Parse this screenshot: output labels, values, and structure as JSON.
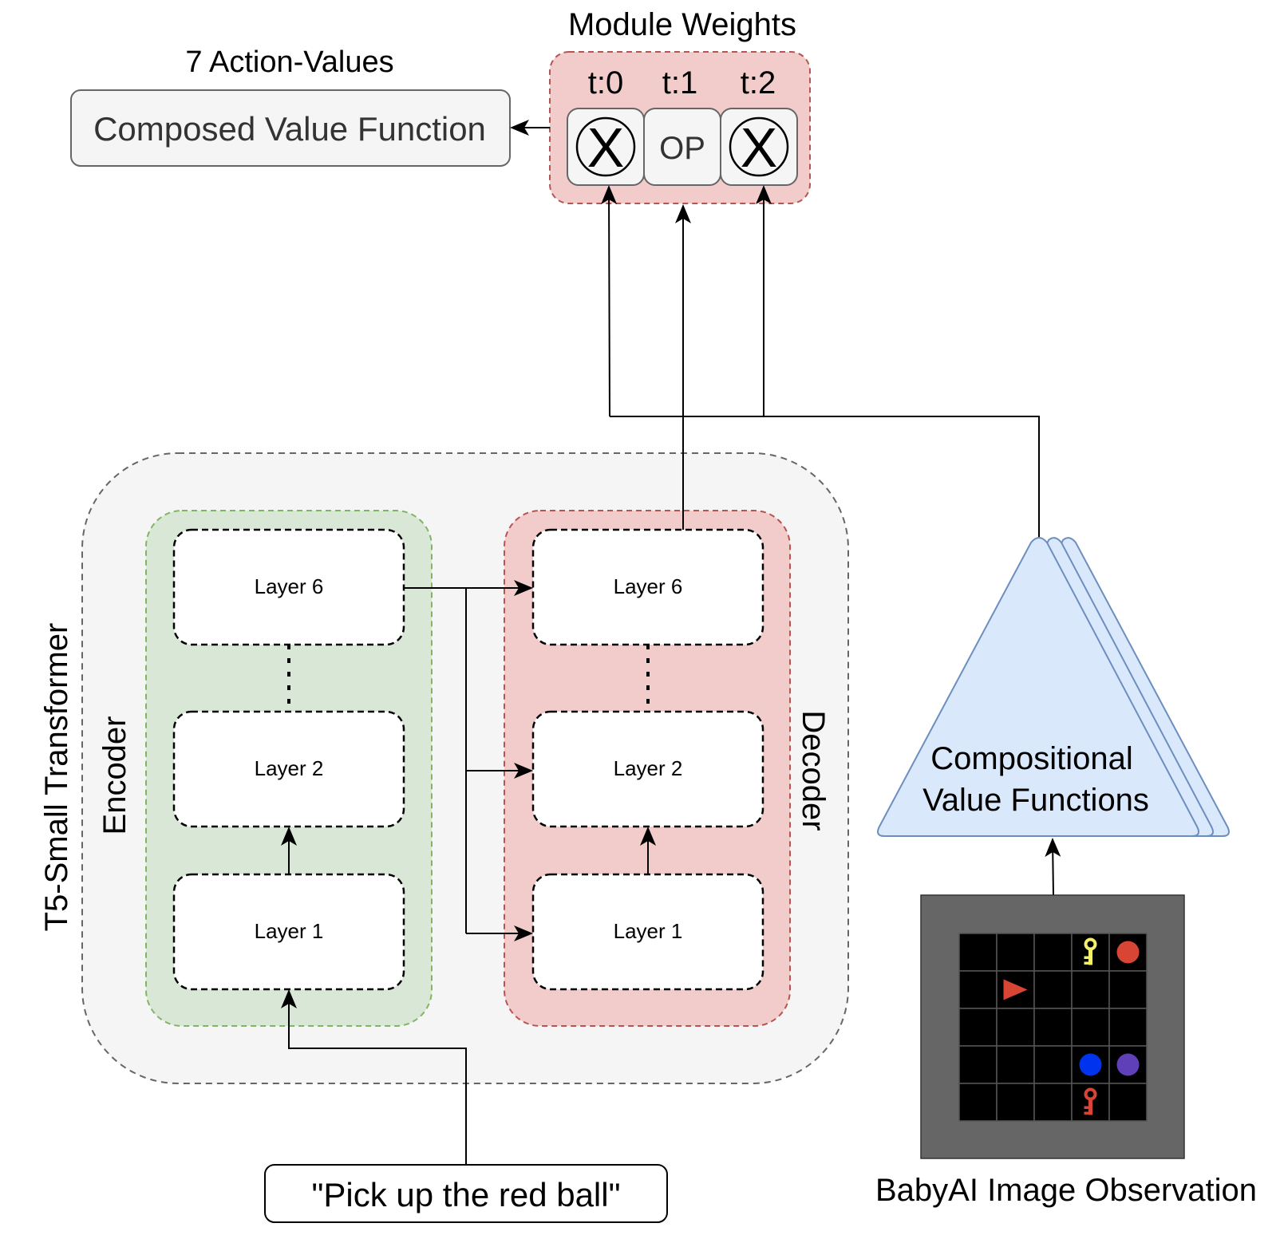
{
  "top": {
    "module_weights_title": "Module Weights",
    "action_values_title": "7 Action-Values",
    "composed_value_function": "Composed Value Function",
    "module_slots": [
      {
        "label": "t:0",
        "content": "multiply-circle-icon"
      },
      {
        "label": "t:1",
        "content": "OP"
      },
      {
        "label": "t:2",
        "content": "multiply-circle-icon"
      }
    ],
    "multiply_glyph": "X"
  },
  "transformer": {
    "title": "T5-Small Transformer",
    "encoder": {
      "label": "Encoder",
      "layers": [
        "Layer 6",
        "Layer 2",
        "Layer 1"
      ]
    },
    "decoder": {
      "label": "Decoder",
      "layers": [
        "Layer 6",
        "Layer 2",
        "Layer 1"
      ]
    }
  },
  "instruction": "\"Pick up the red ball\"",
  "value_functions": {
    "label_line1": "Compositional",
    "label_line2": "Value Functions"
  },
  "observation": {
    "label": "BabyAI Image Observation",
    "grid_rows": 5,
    "grid_cols": 5,
    "objects": [
      {
        "type": "key",
        "row": 0,
        "col": 3,
        "color": "#f5f06a"
      },
      {
        "type": "ball",
        "row": 0,
        "col": 4,
        "color": "#d94535"
      },
      {
        "type": "agent",
        "row": 1,
        "col": 1,
        "color": "#d94535",
        "direction": "right"
      },
      {
        "type": "ball",
        "row": 3,
        "col": 3,
        "color": "#0033ee"
      },
      {
        "type": "ball",
        "row": 3,
        "col": 4,
        "color": "#6040b8"
      },
      {
        "type": "key",
        "row": 4,
        "col": 3,
        "color": "#d94535"
      }
    ]
  },
  "colors": {
    "module_weights_fill": "#f1cccb",
    "module_weights_stroke": "#b85450",
    "encoder_fill": "#d9e8d6",
    "encoder_stroke": "#82b366",
    "decoder_fill": "#f1cccb",
    "decoder_stroke": "#b85450",
    "transformer_fill": "#f5f5f5",
    "vf_fill": "#dae8fc",
    "vf_stroke": "#6c8ebf",
    "obs_frame": "#666666"
  }
}
